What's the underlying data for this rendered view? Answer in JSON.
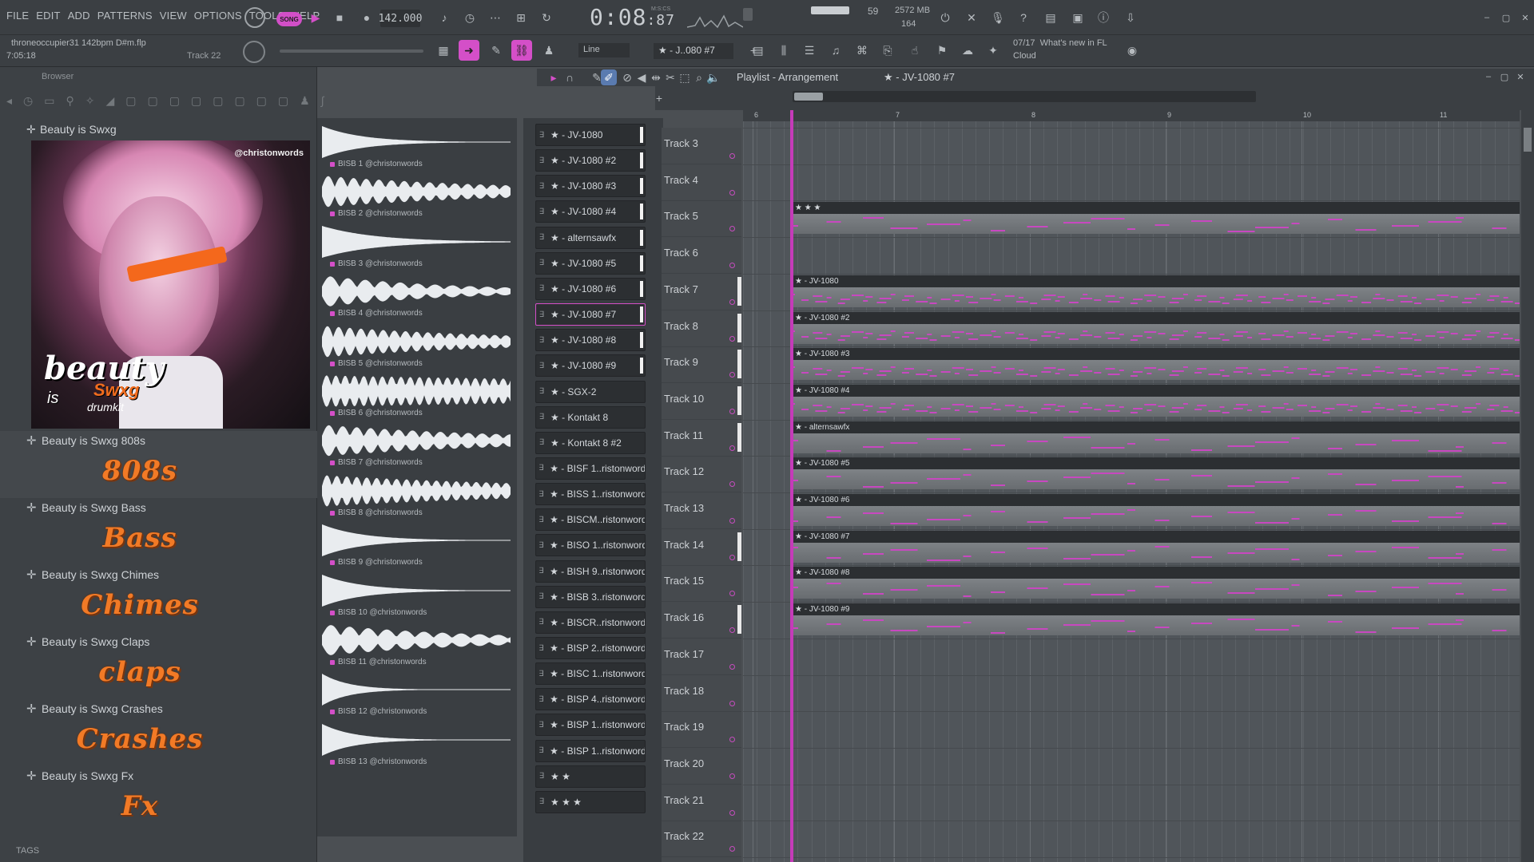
{
  "menu": [
    "FILE",
    "EDIT",
    "ADD",
    "PATTERNS",
    "VIEW",
    "OPTIONS",
    "TOOLS",
    "HELP"
  ],
  "transport": {
    "mode": "SONG",
    "tempo": "142.000",
    "time_main": "0:08",
    "time_small": ":87",
    "time_mode": "M:S:CS"
  },
  "status": {
    "cpu": "59",
    "memory": "2572 MB",
    "polyphony": "164"
  },
  "project": {
    "name": "throneoccupier31 142bpm D#m.flp",
    "length": "7:05:18",
    "hint_track": "Track 22"
  },
  "snap": {
    "value": "Line"
  },
  "pattern": {
    "name": "★ - J..080 #7"
  },
  "news": {
    "count": "07/17",
    "title": "What's new in FL",
    "subtitle": "Cloud"
  },
  "browser": {
    "title": "Browser",
    "root": "Beauty is Swxg",
    "art": {
      "credit": "@christonwords",
      "logo_top": "beauty",
      "logo_mid": "Swxg",
      "logo_is": "is",
      "logo_bottom": "drumkit"
    },
    "packs": [
      {
        "label": "Beauty is Swxg 808s",
        "banner": "808s"
      },
      {
        "label": "Beauty is Swxg Bass",
        "banner": "Bass"
      },
      {
        "label": "Beauty is Swxg Chimes",
        "banner": "Chimes"
      },
      {
        "label": "Beauty is Swxg Claps",
        "banner": "claps"
      },
      {
        "label": "Beauty is Swxg Crashes",
        "banner": "Crashes"
      },
      {
        "label": "Beauty is Swxg Fx",
        "banner": "Fx"
      }
    ],
    "tags": "TAGS"
  },
  "samples": [
    "BISB 1 @christonwords",
    "BISB 2 @christonwords",
    "BISB 3 @christonwords",
    "BISB 4 @christonwords",
    "BISB 5 @christonwords",
    "BISB 6 @christonwords",
    "BISB 7 @christonwords",
    "BISB 8 @christonwords",
    "BISB 9 @christonwords",
    "BISB 10 @christonwords",
    "BISB 11 @christonwords",
    "BISB 12 @christonwords",
    "BISB 13 @christonwords"
  ],
  "channels": [
    "★ - JV-1080",
    "★ - JV-1080 #2",
    "★ - JV-1080 #3",
    "★ - JV-1080 #4",
    "★ - alternsawfx",
    "★ - JV-1080 #5",
    "★ - JV-1080 #6",
    "★ - JV-1080 #7",
    "★ - JV-1080 #8",
    "★ - JV-1080 #9",
    "★ - SGX-2",
    "★ - Kontakt 8",
    "★ - Kontakt 8 #2",
    "★ - BISF 1..ristonwords",
    "★ - BISS 1..ristonwords",
    "★ - BISCM..ristonwords",
    "★ - BISO 1..ristonwords",
    "★ - BISH 9..ristonwords",
    "★ - BISB 3..ristonwords",
    "★ - BISCR..ristonwords",
    "★ - BISP 2..ristonwords",
    "★ - BISC 1..ristonwords",
    "★ - BISP 4..ristonwords",
    "★ - BISP 1..ristonwords",
    "★ - BISP 1..ristonwords",
    "★ ★",
    "★ ★ ★"
  ],
  "playlist": {
    "title": "Playlist - Arrangement",
    "pattern": "★ - JV-1080 #7",
    "ruler": [
      "6",
      "7",
      "8",
      "9",
      "10",
      "11"
    ],
    "tracks": [
      "Track 3",
      "Track 4",
      "Track 5",
      "Track 6",
      "Track 7",
      "Track 8",
      "Track 9",
      "Track 10",
      "Track 11",
      "Track 12",
      "Track 13",
      "Track 14",
      "Track 15",
      "Track 16",
      "Track 17",
      "Track 18",
      "Track 19",
      "Track 20",
      "Track 21",
      "Track 22"
    ],
    "clips": [
      {
        "row": 2,
        "label": "★ ★ ★"
      },
      {
        "row": 4,
        "label": "★ - JV-1080"
      },
      {
        "row": 5,
        "label": "★ - JV-1080 #2"
      },
      {
        "row": 6,
        "label": "★ - JV-1080 #3"
      },
      {
        "row": 7,
        "label": "★ - JV-1080 #4"
      },
      {
        "row": 8,
        "label": "★ - alternsawfx"
      },
      {
        "row": 9,
        "label": "★ - JV-1080 #5"
      },
      {
        "row": 10,
        "label": "★ - JV-1080 #6"
      },
      {
        "row": 11,
        "label": "★ - JV-1080 #7"
      },
      {
        "row": 12,
        "label": "★ - JV-1080 #8"
      },
      {
        "row": 13,
        "label": "★ - JV-1080 #9"
      }
    ]
  },
  "colors": {
    "accent": "#d44fc8",
    "banner": "#f27a26",
    "panel": "#3b3f43"
  }
}
